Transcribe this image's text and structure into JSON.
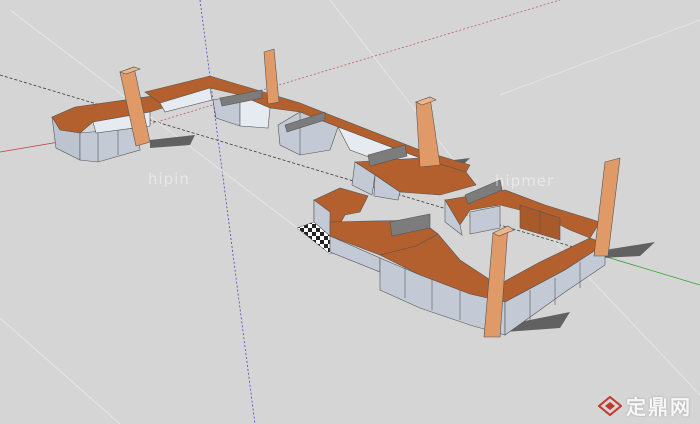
{
  "watermarks": {
    "left": "hipin",
    "right": "hipmer"
  },
  "brand": {
    "text": "定鼎网",
    "icon": "diamond-logo-icon"
  },
  "colors": {
    "ground": "#d5d5d5",
    "wood_top": "#b35f2e",
    "cabinet_face": "#c3cad6",
    "cabinet_light": "#e6ebf2",
    "pillar": "#df9a68",
    "axis_red": "#c04040",
    "axis_green": "#30a030",
    "axis_blue": "#4040c0",
    "partition": "#7c7c7c"
  }
}
